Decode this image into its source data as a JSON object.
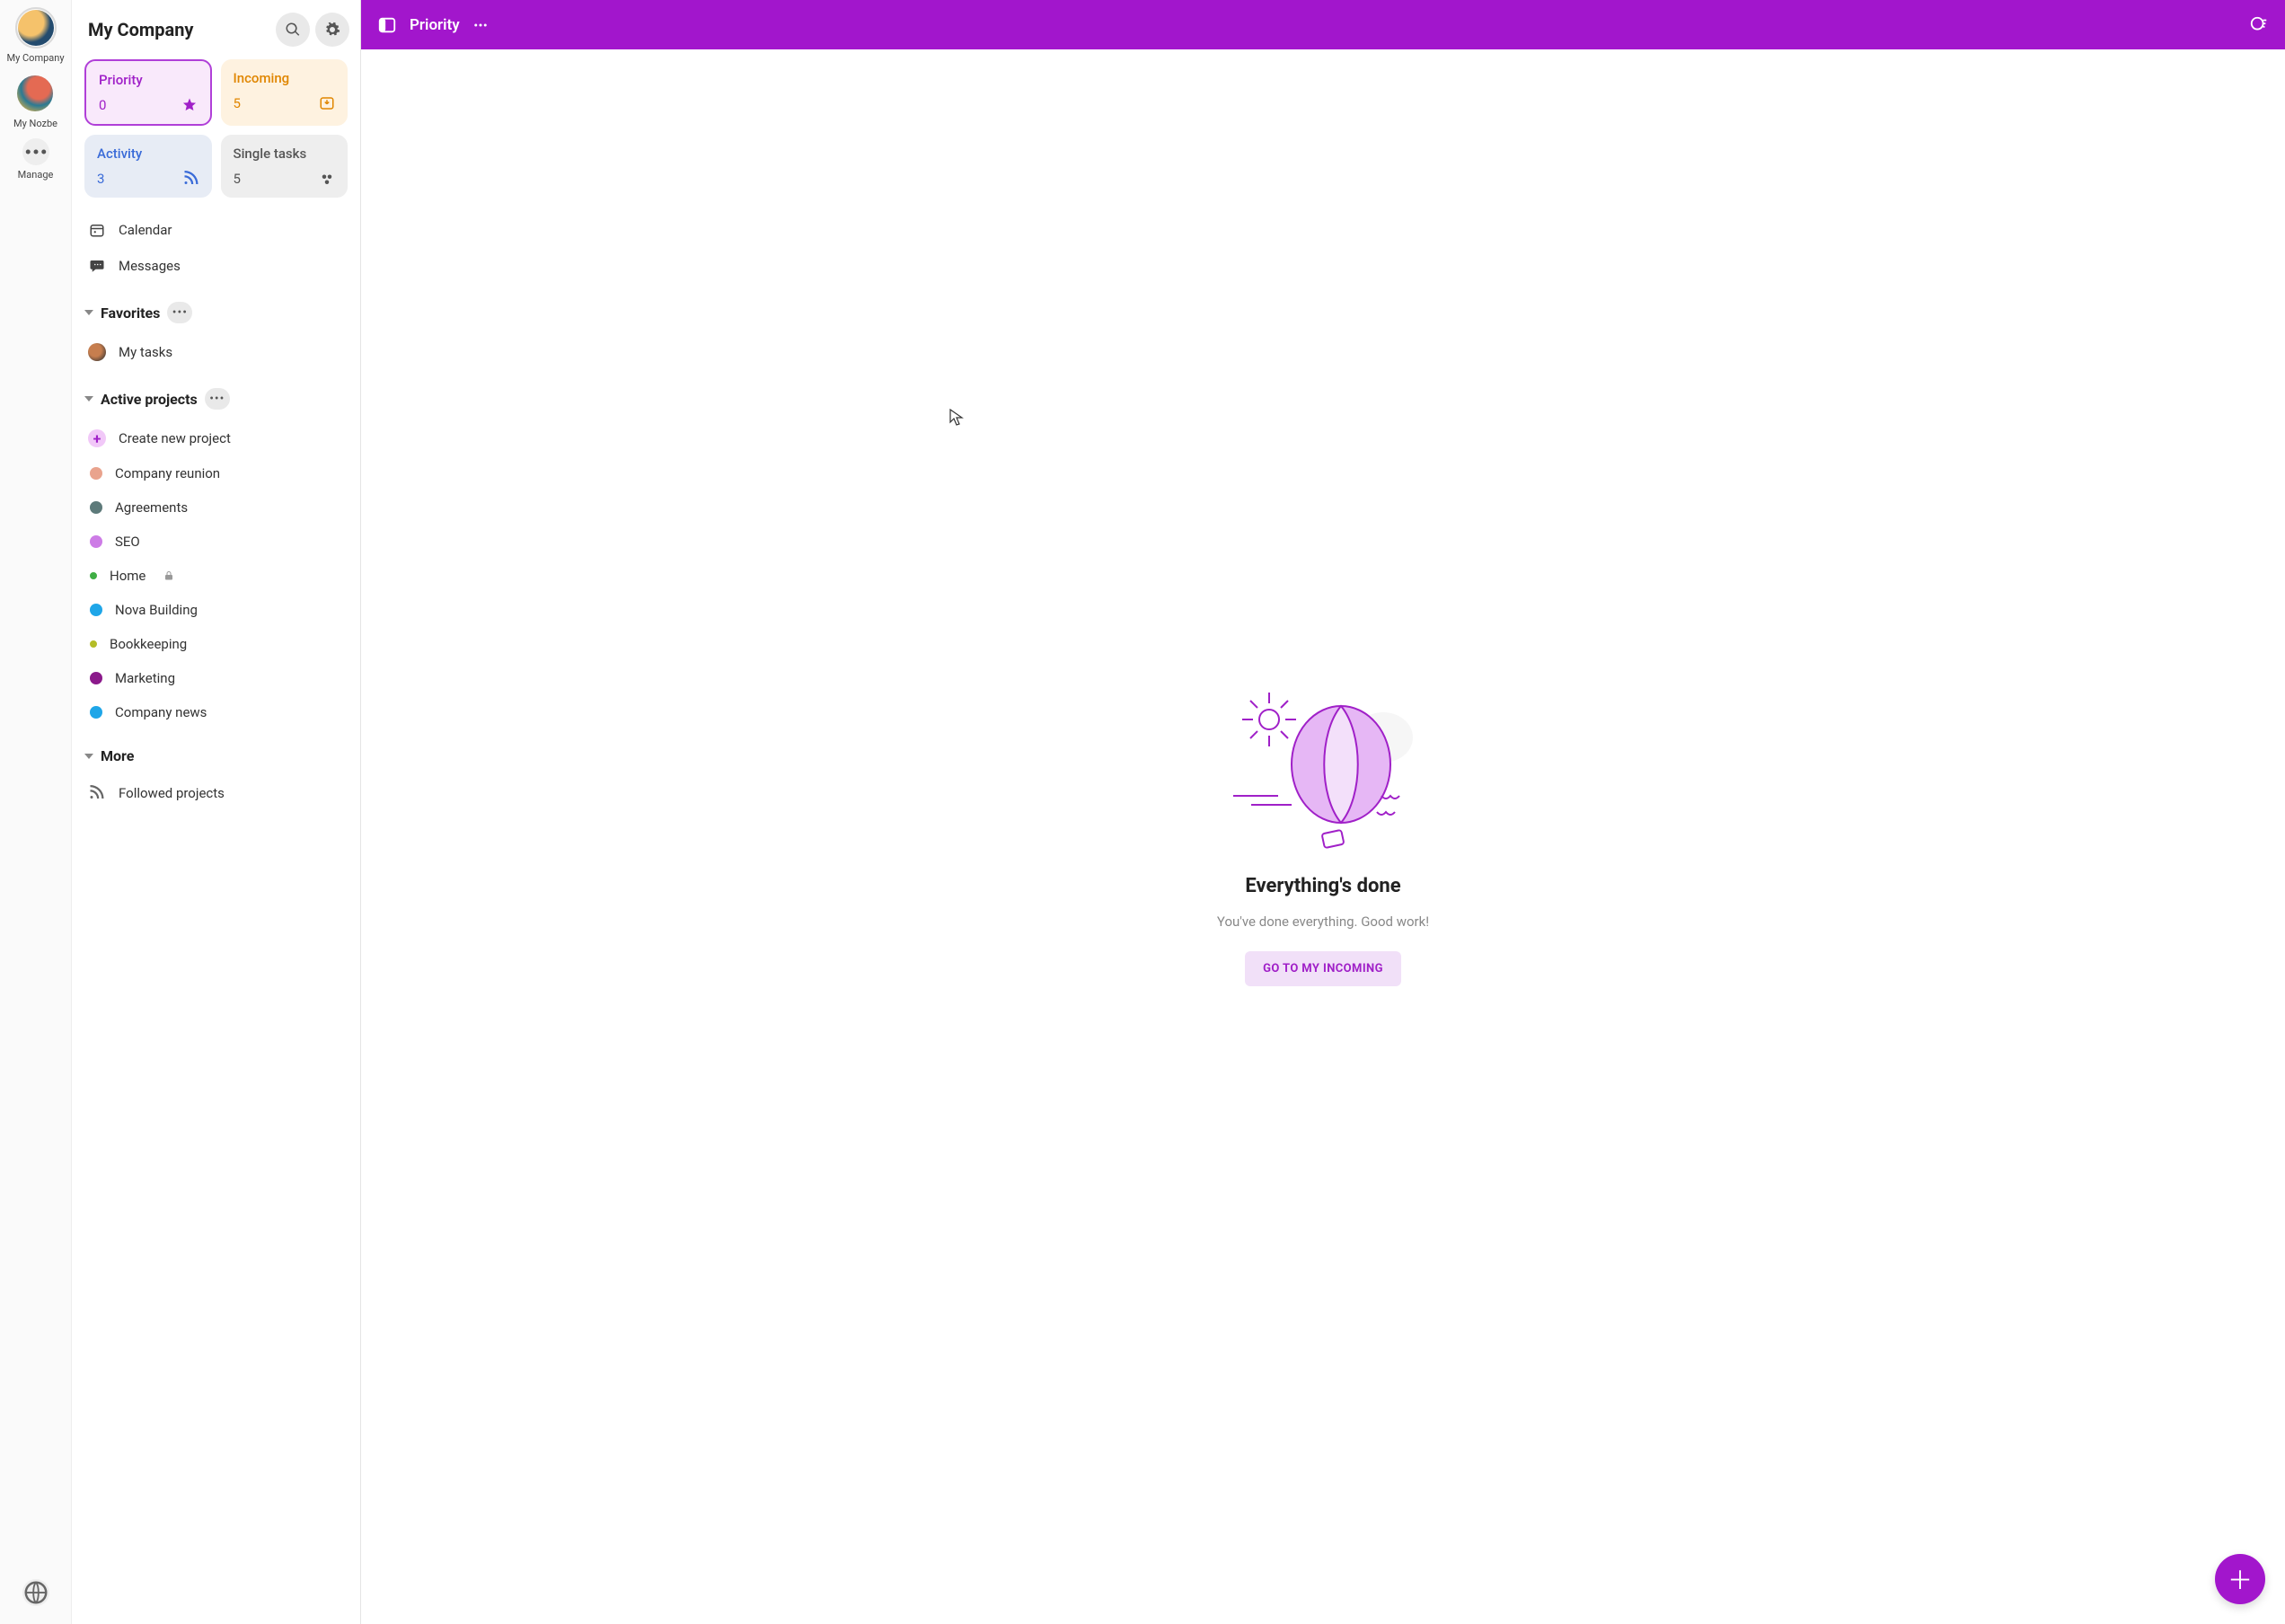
{
  "rail": {
    "spaces": [
      {
        "label": "My Company",
        "color1": "#f5c26b",
        "color2": "#234b6e"
      },
      {
        "label": "My Nozbe",
        "color1": "#e46a53",
        "color2": "#2a7a93"
      }
    ],
    "manage_label": "Manage"
  },
  "sidebar": {
    "title": "My Company",
    "cards": {
      "priority": {
        "title": "Priority",
        "count": "0"
      },
      "incoming": {
        "title": "Incoming",
        "count": "5"
      },
      "activity": {
        "title": "Activity",
        "count": "3"
      },
      "single": {
        "title": "Single tasks",
        "count": "5"
      }
    },
    "calendar": "Calendar",
    "messages": "Messages",
    "sections": {
      "favorites": "Favorites",
      "active": "Active projects",
      "more": "More"
    },
    "favorites_items": [
      "My tasks"
    ],
    "create_project": "Create new project",
    "projects": [
      {
        "name": "Company reunion",
        "color": "#e9a38d",
        "locked": false
      },
      {
        "name": "Agreements",
        "color": "#5d7a7a",
        "locked": false
      },
      {
        "name": "SEO",
        "color": "#cd7ce6",
        "locked": false
      },
      {
        "name": "Home",
        "color": "#3fae44",
        "locked": true,
        "ring": true
      },
      {
        "name": "Nova Building",
        "color": "#1fa6e8",
        "locked": false
      },
      {
        "name": "Bookkeeping",
        "color": "#b4bd27",
        "locked": false,
        "ring": true
      },
      {
        "name": "Marketing",
        "color": "#8b1a8b",
        "locked": false
      },
      {
        "name": "Company news",
        "color": "#1fa6e8",
        "locked": false
      }
    ],
    "followed": "Followed projects"
  },
  "topbar": {
    "title": "Priority"
  },
  "empty": {
    "title": "Everything's done",
    "subtitle": "You've done everything. Good work!",
    "cta": "GO TO MY INCOMING"
  }
}
